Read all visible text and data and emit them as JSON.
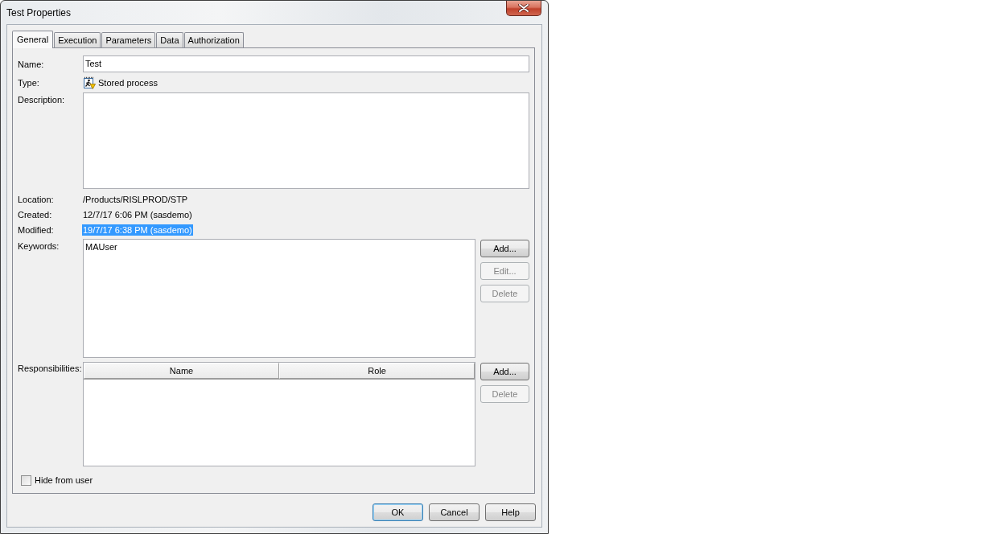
{
  "window": {
    "title": "Test Properties"
  },
  "tabs": [
    {
      "label": "General",
      "selected": true
    },
    {
      "label": "Execution",
      "selected": false
    },
    {
      "label": "Parameters",
      "selected": false
    },
    {
      "label": "Data",
      "selected": false
    },
    {
      "label": "Authorization",
      "selected": false
    }
  ],
  "general_tab": {
    "name": {
      "label": "Name:",
      "value": "Test"
    },
    "type": {
      "label": "Type:",
      "value": "Stored process"
    },
    "description": {
      "label": "Description:"
    },
    "info_rows": [
      {
        "label": "Location:",
        "value": "/Products/RISLPROD/STP",
        "selected": false
      },
      {
        "label": "Created:",
        "value": "12/7/17 6:06 PM (sasdemo)",
        "selected": false
      },
      {
        "label": "Modified:",
        "value": "19/7/17 6:38 PM (sasdemo)",
        "selected": true
      }
    ],
    "keywords": {
      "label": "Keywords:",
      "items": [
        {
          "text": "MAUser",
          "selected": false
        }
      ],
      "buttons": [
        {
          "label": "Add...",
          "disabled": false
        },
        {
          "label": "Edit...",
          "disabled": true
        },
        {
          "label": "Delete",
          "disabled": true
        }
      ]
    },
    "responsibilities": {
      "label": "Responsibilities:",
      "columns": [
        "Name",
        "Role"
      ],
      "buttons": [
        {
          "label": "Add...",
          "disabled": false
        },
        {
          "label": "Delete",
          "disabled": true
        }
      ]
    },
    "hide_from_user": {
      "label": "Hide from user",
      "checked": false
    }
  },
  "buttons": [
    {
      "label": "OK",
      "default": true
    },
    {
      "label": "Cancel",
      "default": false
    },
    {
      "label": "Help",
      "default": false
    }
  ]
}
